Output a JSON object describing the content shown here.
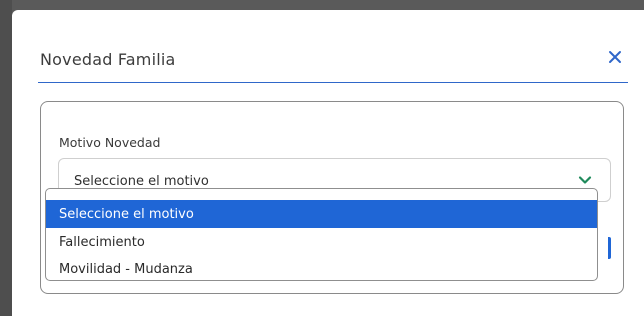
{
  "modal": {
    "title": "Novedad Familia",
    "close_icon": "close-icon"
  },
  "form": {
    "field_label": "Motivo Novedad",
    "select": {
      "value": "Seleccione el motivo",
      "icon": "chevron-down-icon"
    }
  },
  "dropdown": {
    "options": [
      {
        "label": "Seleccione el motivo",
        "selected": true
      },
      {
        "label": "Fallecimiento",
        "selected": false
      },
      {
        "label": "Movilidad - Mudanza",
        "selected": false
      }
    ]
  },
  "colors": {
    "accent": "#2f67c9",
    "selected_option": "#1f66d6",
    "chevron": "#1f8a5b"
  }
}
